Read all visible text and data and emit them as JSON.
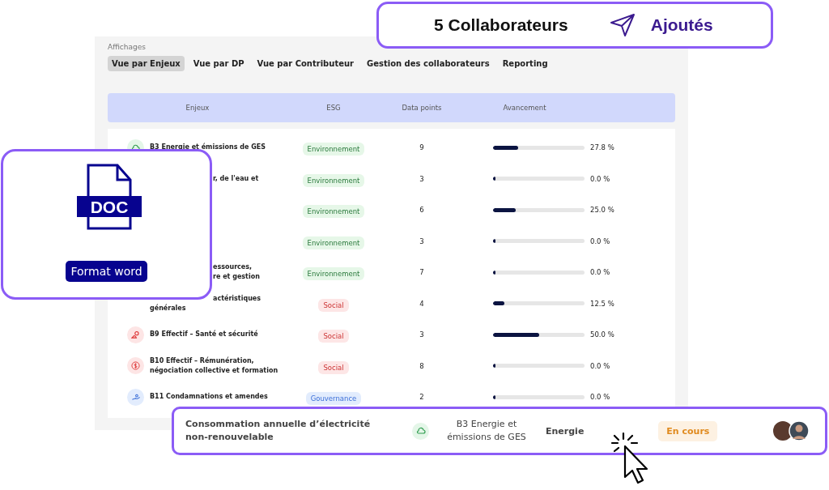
{
  "section_label": "Affichages",
  "tabs": [
    {
      "label": "Vue par Enjeux",
      "selected": true
    },
    {
      "label": "Vue par DP",
      "selected": false
    },
    {
      "label": "Vue par Contributeur",
      "selected": false
    },
    {
      "label": "Gestion des collaborateurs",
      "selected": false
    },
    {
      "label": "Reporting",
      "selected": false
    }
  ],
  "table": {
    "columns": [
      "Enjeux",
      "ESG",
      "Data points",
      "Avancement"
    ],
    "rows": [
      {
        "kind": "environment",
        "title": "B3 Energie et émissions de GES",
        "esg": "Environnement",
        "data_points": "9",
        "level": 0.278,
        "reading": "27.8 %"
      },
      {
        "kind": "environment",
        "title_tail": [
          "r, de l'eau et"
        ],
        "esg": "Environnement",
        "data_points": "3",
        "level": 0,
        "reading": "0.0 %"
      },
      {
        "kind": "environment",
        "esg": "Environnement",
        "data_points": "6",
        "level": 0.25,
        "reading": "25.0 %"
      },
      {
        "kind": "environment",
        "esg": "Environnement",
        "data_points": "3",
        "level": 0,
        "reading": "0.0 %"
      },
      {
        "kind": "environment",
        "title_tail": [
          "essources,",
          "re et gestion"
        ],
        "esg": "Environnement",
        "data_points": "7",
        "level": 0,
        "reading": "0.0 %"
      },
      {
        "kind": "social",
        "title_tail": [
          "actéristiques"
        ],
        "title": "générales",
        "esg": "Social",
        "data_points": "4",
        "level": 0.125,
        "reading": "12.5 %"
      },
      {
        "kind": "social",
        "title": "B9 Effectif – Santé et sécurité",
        "esg": "Social",
        "data_points": "3",
        "level": 0.5,
        "reading": "50.0 %"
      },
      {
        "kind": "social",
        "title": "B10 Effectif – Rémunération, négociation collective et formation",
        "esg": "Social",
        "data_points": "8",
        "level": 0,
        "reading": "0.0 %"
      },
      {
        "kind": "governance",
        "title": "B11 Condamnations et amendes",
        "esg": "Gouvernance",
        "data_points": "2",
        "level": 0,
        "reading": "0.0 %"
      }
    ]
  },
  "added_banner": {
    "count_text": "5 Collaborateurs",
    "status": "Ajoutés"
  },
  "doc_card": {
    "file_label": "DOC",
    "button": "Format word"
  },
  "task_card": {
    "title": "Consommation annuelle d’électricité non-renouvelable",
    "enjeu": "B3 Energie et émissions de GES",
    "category": "Energie",
    "status": "En cours"
  }
}
